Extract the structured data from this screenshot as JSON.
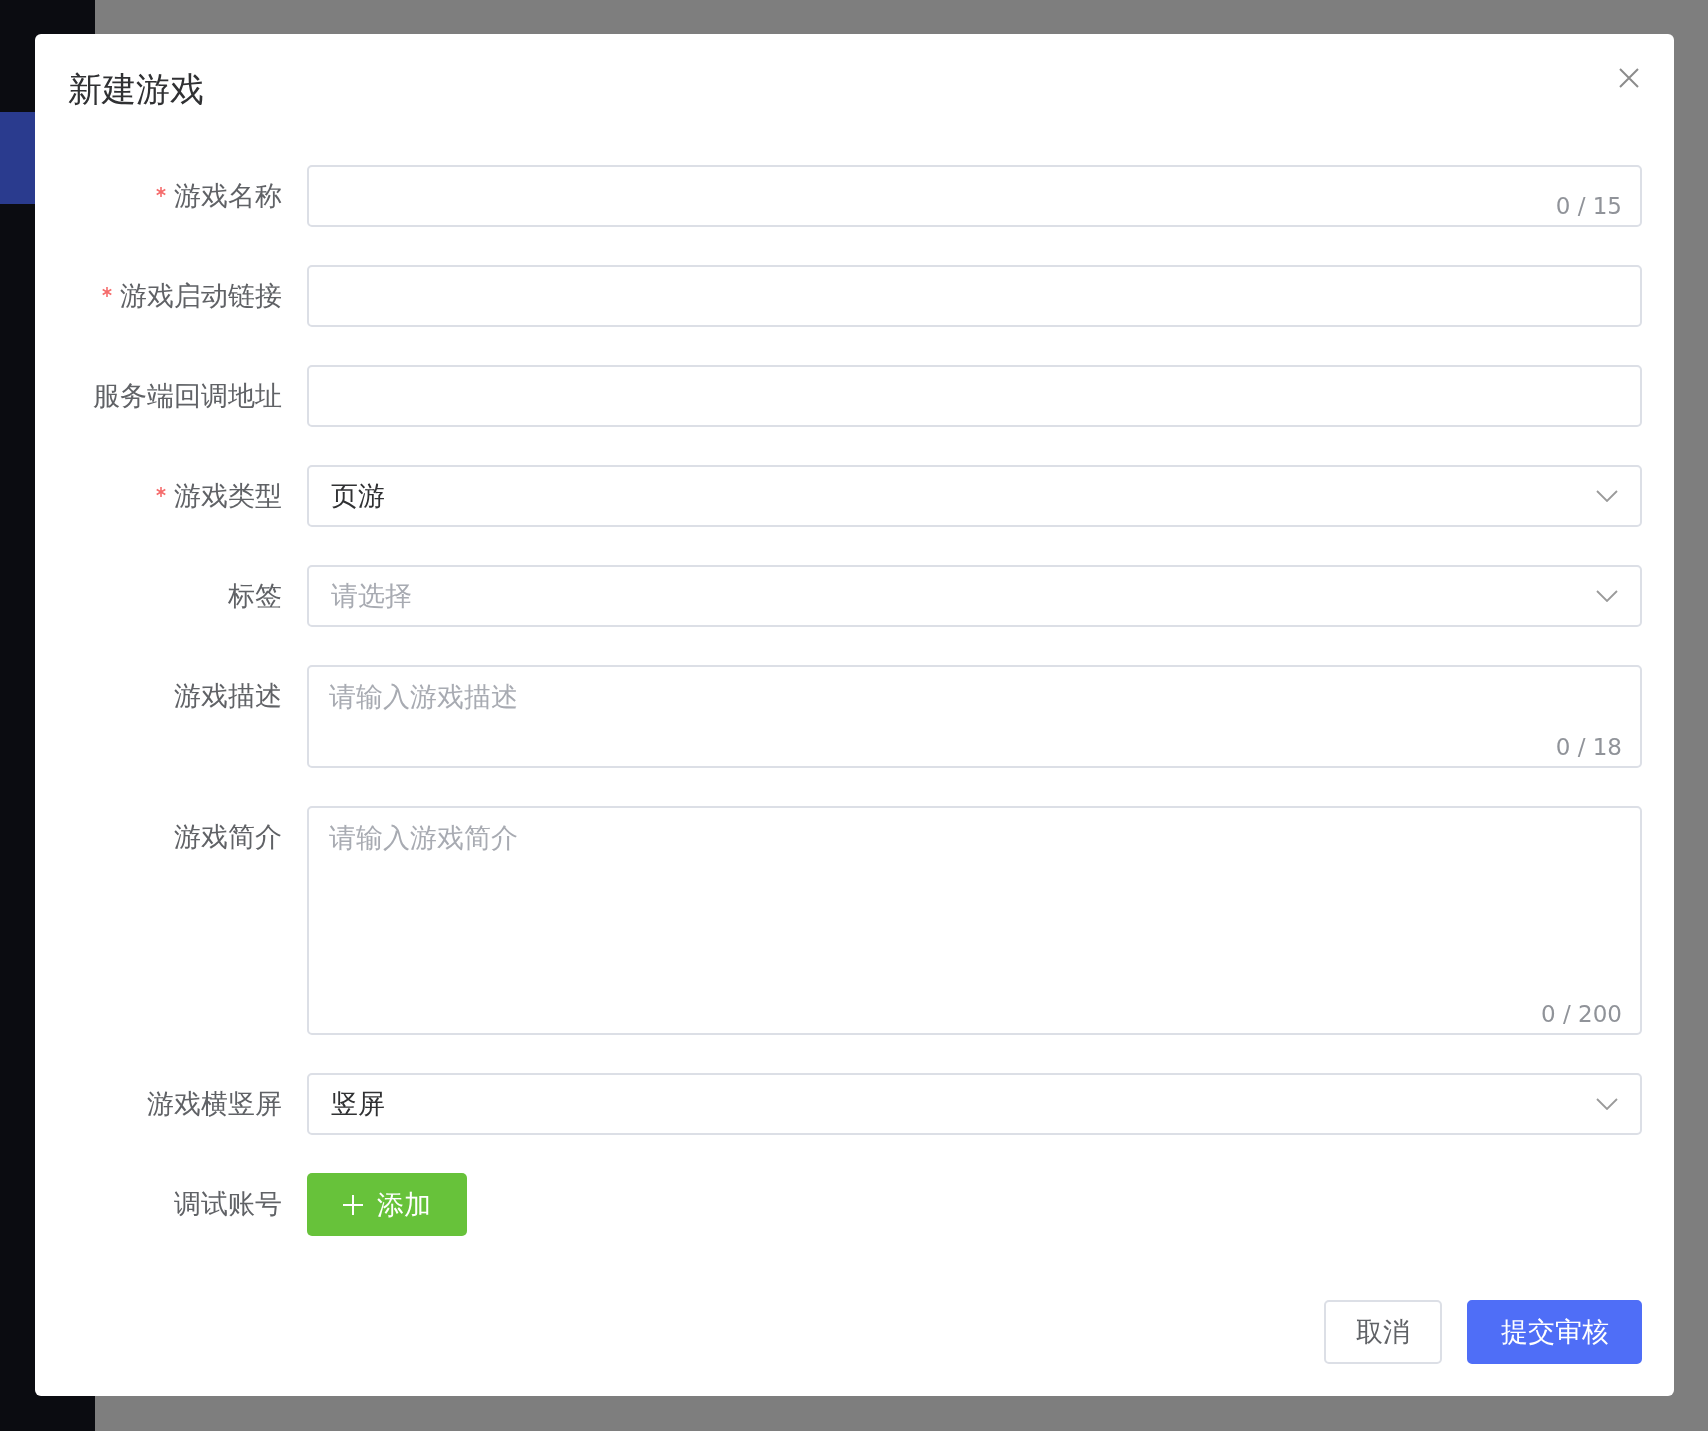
{
  "dialog": {
    "title": "新建游戏",
    "fields": [
      {
        "label": "游戏名称",
        "required": true,
        "kind": "text",
        "counter": "0 / 15"
      },
      {
        "label": "游戏启动链接",
        "required": true,
        "kind": "text"
      },
      {
        "label": "服务端回调地址",
        "required": false,
        "kind": "text"
      },
      {
        "label": "游戏类型",
        "required": true,
        "kind": "select",
        "value": "页游"
      },
      {
        "label": "标签",
        "required": false,
        "kind": "select",
        "placeholder": "请选择"
      },
      {
        "label": "游戏描述",
        "required": false,
        "kind": "textarea",
        "placeholder": "请输入游戏描述",
        "counter": "0 / 18"
      },
      {
        "label": "游戏简介",
        "required": false,
        "kind": "long_textarea",
        "placeholder": "请输入游戏简介",
        "counter": "0 / 200"
      },
      {
        "label": "游戏横竖屏",
        "required": false,
        "kind": "select",
        "value": "竖屏"
      },
      {
        "label": "调试账号",
        "required": false,
        "kind": "add",
        "button": "添加"
      }
    ],
    "buttons": [
      {
        "label": "取消",
        "kind": "default"
      },
      {
        "label": "提交审核",
        "kind": "primary"
      }
    ]
  }
}
